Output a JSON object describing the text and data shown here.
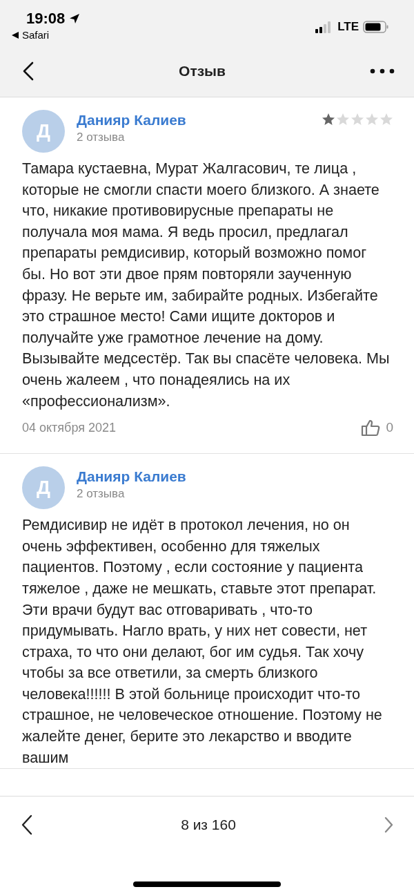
{
  "status_bar": {
    "time": "19:08",
    "back_app": "Safari",
    "network": "LTE"
  },
  "nav": {
    "title": "Отзыв"
  },
  "reviews": [
    {
      "avatar": "Д",
      "author": "Данияр Калиев",
      "review_count": "2 отзыва",
      "stars": 1,
      "text": "Тамара кустаевна, Мурат Жалгасович, те лица , которые не смогли спасти моего близкого. А знаете что, никакие противовирусные препараты не получала моя мама. Я ведь просил, предлагал препараты ремдисивир, который возможно помог бы. Но вот эти двое прям повторяли заученную фразу. Не верьте им, забирайте родных. Избегайте это страшное место! Сами ищите докторов и получайте уже грамотное лечение на дому. Вызывайте медсестёр. Так вы спасёте человека. Мы очень жалеем , что понадеялись на их «профессионализм».",
      "date": "04 октября 2021",
      "likes": "0"
    },
    {
      "avatar": "Д",
      "author": "Данияр Калиев",
      "review_count": "2 отзыва",
      "text": "Ремдисивир не идёт в протокол лечения, но он очень эффективен, особенно для тяжелых пациентов. Поэтому , если состояние у пациента тяжелое , даже не мешкать, ставьте этот препарат. Эти врачи будут вас отговаривать , что-то придумывать. Нагло врать, у них нет совести, нет страха, то что они делают, бог им судья. Так хочу чтобы за все ответили, за смерть близкого человека!!!!!! В этой больнице происходит что-то страшное, не человеческое отношение. Поэтому не жалейте денег, берите это лекарство и вводите вашим"
    }
  ],
  "pager": {
    "label": "8 из 160",
    "prev_enabled": true,
    "next_enabled": false
  }
}
